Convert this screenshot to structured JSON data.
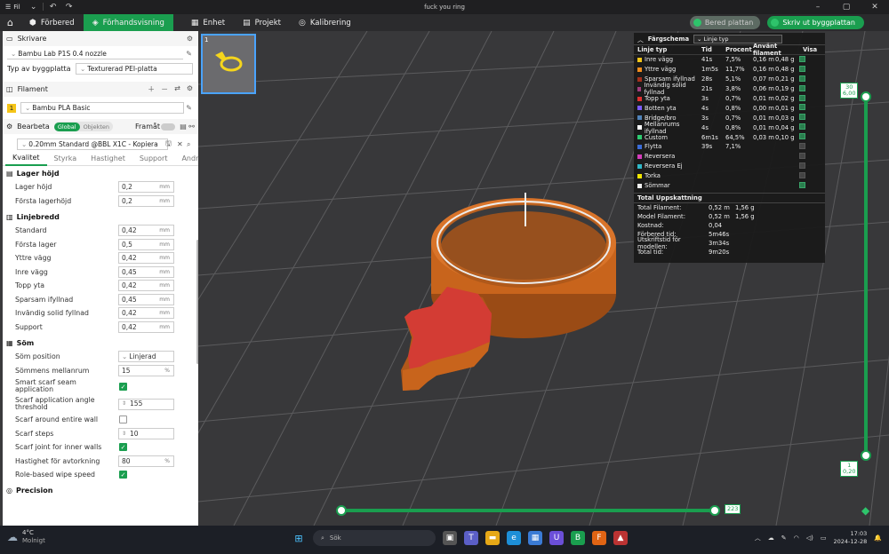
{
  "titlebar": {
    "file_menu": "Fil",
    "window_title": "fuck you ring"
  },
  "tabs": [
    {
      "label": "Förbered"
    },
    {
      "label": "Förhandsvisning"
    },
    {
      "label": "Enhet"
    },
    {
      "label": "Projekt"
    },
    {
      "label": "Kalibrering"
    }
  ],
  "actions": {
    "slice_label": "Bered plattan",
    "print_label": "Skriv ut byggplattan"
  },
  "printer": {
    "header": "Skrivare",
    "name": "Bambu Lab P1S 0.4 nozzle",
    "plate_label": "Typ av byggplatta",
    "plate_value": "Texturerad PEI-platta"
  },
  "filament": {
    "header": "Filament",
    "slot": "1",
    "name": "Bambu PLA Basic"
  },
  "process": {
    "header": "Bearbeta",
    "toggle_global": "Global",
    "toggle_objects": "Objekten",
    "advanced_label": "Framåt",
    "preset": "0.20mm Standard @BBL X1C - Kopiera",
    "subtabs": [
      "Kvalitet",
      "Styrka",
      "Hastighet",
      "Support",
      "Andra"
    ]
  },
  "groups": {
    "layer_height": {
      "title": "Lager höjd",
      "rows": [
        {
          "label": "Lager höjd",
          "value": "0,2",
          "unit": "mm"
        },
        {
          "label": "Första lagerhöjd",
          "value": "0,2",
          "unit": "mm"
        }
      ]
    },
    "line_width": {
      "title": "Linjebredd",
      "rows": [
        {
          "label": "Standard",
          "value": "0,42",
          "unit": "mm"
        },
        {
          "label": "Första lager",
          "value": "0,5",
          "unit": "mm"
        },
        {
          "label": "Yttre vägg",
          "value": "0,42",
          "unit": "mm"
        },
        {
          "label": "Inre vägg",
          "value": "0,45",
          "unit": "mm"
        },
        {
          "label": "Topp yta",
          "value": "0,42",
          "unit": "mm"
        },
        {
          "label": "Sparsam ifyllnad",
          "value": "0,45",
          "unit": "mm"
        },
        {
          "label": "Invändig solid fyllnad",
          "value": "0,42",
          "unit": "mm"
        },
        {
          "label": "Support",
          "value": "0,42",
          "unit": "mm"
        }
      ]
    },
    "seam": {
      "title": "Söm",
      "position_label": "Söm position",
      "position_value": "Linjerad",
      "gap_label": "Sömmens mellanrum",
      "gap_value": "15",
      "gap_unit": "%",
      "smart_label_1": "Smart scarf seam",
      "smart_label_2": "application",
      "angle_label_1": "Scarf application angle",
      "angle_label_2": "threshold",
      "angle_value": "155",
      "around_wall_label": "Scarf around entire wall",
      "steps_label": "Scarf steps",
      "steps_value": "10",
      "inner_walls_label": "Scarf joint for inner walls",
      "wipe_speed_label": "Hastighet för avtorkning",
      "wipe_speed_value": "80",
      "wipe_speed_unit": "%",
      "role_wipe_label": "Role-based wipe speed"
    },
    "precision": {
      "title": "Precision"
    }
  },
  "legend": {
    "title": "Färgschema",
    "select": "Linje typ",
    "columns": [
      "Linje typ",
      "Tid",
      "Procent",
      "Använt filament",
      "Visa"
    ],
    "rows": [
      {
        "name": "Inre vägg",
        "time": "41s",
        "pct": "7,5%",
        "len": "0,16 m",
        "g": "0,48 g",
        "color": "#f5c518",
        "show": true
      },
      {
        "name": "Yttre vägg",
        "time": "1m5s",
        "pct": "11,7%",
        "len": "0,16 m",
        "g": "0,48 g",
        "color": "#f08c1c",
        "show": true
      },
      {
        "name": "Sparsam ifyllnad",
        "time": "28s",
        "pct": "5,1%",
        "len": "0,07 m",
        "g": "0,21 g",
        "color": "#a3301c",
        "show": true
      },
      {
        "name": "Invändig solid fyllnad",
        "time": "21s",
        "pct": "3,8%",
        "len": "0,06 m",
        "g": "0,19 g",
        "color": "#a13c7e",
        "show": true
      },
      {
        "name": "Topp yta",
        "time": "3s",
        "pct": "0,7%",
        "len": "0,01 m",
        "g": "0,02 g",
        "color": "#e03030",
        "show": true
      },
      {
        "name": "Botten yta",
        "time": "4s",
        "pct": "0,8%",
        "len": "0,00 m",
        "g": "0,01 g",
        "color": "#7a5cff",
        "show": true
      },
      {
        "name": "Bridge/bro",
        "time": "3s",
        "pct": "0,7%",
        "len": "0,01 m",
        "g": "0,03 g",
        "color": "#4f82b8",
        "show": true
      },
      {
        "name": "Mellanrums ifyllnad",
        "time": "4s",
        "pct": "0,8%",
        "len": "0,01 m",
        "g": "0,04 g",
        "color": "#ffffff",
        "show": true
      },
      {
        "name": "Custom",
        "time": "6m1s",
        "pct": "64,5%",
        "len": "0,03 m",
        "g": "0,10 g",
        "color": "#2ecc71",
        "show": true
      },
      {
        "name": "Flytta",
        "time": "39s",
        "pct": "7,1%",
        "len": "",
        "g": "",
        "color": "#3a6cd8",
        "show": false
      },
      {
        "name": "Reversera",
        "time": "",
        "pct": "",
        "len": "",
        "g": "",
        "color": "#d63cbc",
        "show": false
      },
      {
        "name": "Reversera Ej",
        "time": "",
        "pct": "",
        "len": "",
        "g": "",
        "color": "#2fb8c8",
        "show": false
      },
      {
        "name": "Torka",
        "time": "",
        "pct": "",
        "len": "",
        "g": "",
        "color": "#f2e600",
        "show": false
      },
      {
        "name": "Sömmar",
        "time": "",
        "pct": "",
        "len": "",
        "g": "",
        "color": "#f0f0f0",
        "show": true
      }
    ],
    "totals_title": "Total Uppskattning",
    "totals": [
      {
        "k": "Total Filament:",
        "v1": "0,52 m",
        "v2": "1,56 g"
      },
      {
        "k": "Model Filament:",
        "v1": "0,52 m",
        "v2": "1,56 g"
      },
      {
        "k": "Kostnad:",
        "v1": "0,04",
        "v2": ""
      },
      {
        "k": "Förbered tid:",
        "v1": "5m46s",
        "v2": ""
      },
      {
        "k": "Utskriftstid för modellen:",
        "v1": "3m34s",
        "v2": ""
      },
      {
        "k": "Total tid:",
        "v1": "9m20s",
        "v2": ""
      }
    ]
  },
  "layer_slider": {
    "top_layer": "30",
    "top_height": "6,00",
    "bottom_layer": "1",
    "bottom_height": "0,20"
  },
  "move_slider": {
    "value": "223"
  },
  "plate_thumb": {
    "number": "1"
  },
  "taskbar": {
    "temp": "4°C",
    "weather": "Molnigt",
    "search": "Sök",
    "time": "17:03",
    "date": "2024-12-28"
  },
  "colors": {
    "accent": "#1a9e4f",
    "model": "#c8641c"
  }
}
